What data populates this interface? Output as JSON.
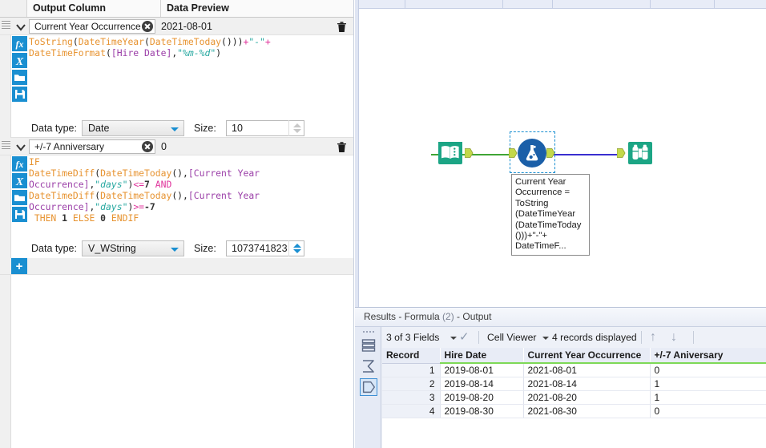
{
  "config_panel": {
    "columns": [
      "Output Column",
      "Data Preview"
    ],
    "formulas": [
      {
        "output_column": "Current Year Occurrence",
        "data_preview": "2021-08-01",
        "expression_plain": "ToString(DateTimeYear(DateTimeToday()))+\"-\"+DateTimeFormat([Hire Date],\"%m-%d\")",
        "data_type_label": "Data type:",
        "data_type": "Date",
        "size_label": "Size:",
        "size": "10",
        "spinner_enabled": false
      },
      {
        "output_column": "+/-7 Anniversary",
        "data_preview": "0",
        "expression_plain": "IF DateTimeDiff(DateTimeToday(),[Current Year Occurrence],\"days\")<=7 AND DateTimeDiff(DateTimeToday(),[Current Year Occurrence],\"days\")>=-7 THEN 1 ELSE 0 ENDIF",
        "data_type_label": "Data type:",
        "data_type": "V_WString",
        "size_label": "Size:",
        "size": "1073741823",
        "spinner_enabled": true
      }
    ],
    "tool_icons": [
      "fx-icon",
      "x-variable-icon",
      "open-folder-icon",
      "save-disk-icon"
    ],
    "add_button_label": "+"
  },
  "canvas": {
    "nodes": [
      {
        "id": "input-data-tool",
        "icon": "open-book-icon",
        "label": ""
      },
      {
        "id": "formula-tool",
        "icon": "flask-icon",
        "label": "Current Year Occurrence = ToString (DateTimeYear (DateTimeToday ()))+\"-\"+ DateTimeF..."
      },
      {
        "id": "browse-tool",
        "icon": "binoculars-icon",
        "label": ""
      }
    ],
    "node_label_lines": [
      "Current Year",
      "Occurrence =",
      "ToString",
      "(DateTimeYear",
      "(DateTimeToday",
      "()))+\"-\"+",
      "DateTimeF..."
    ],
    "colors": {
      "tool_green": "#1CA585",
      "formula_blue": "#1B5FA8",
      "wire_green": "#3FA535",
      "wire_blue": "#3A2FD0",
      "anchor_green": "#C3D84A",
      "selection": "#1a8fd1"
    }
  },
  "results": {
    "title_prefix": "Results - Formula",
    "title_count": "(2)",
    "title_suffix": "- Output",
    "toolbar": {
      "fields": "3 of 3 Fields",
      "viewer": "Cell Viewer",
      "records": "4 records displayed",
      "up_arrow": "↑",
      "down_arrow": "↓",
      "check": "✓"
    },
    "table": {
      "headers": [
        "Record",
        "Hire Date",
        "Current Year Occurrence",
        "+/-7 Aniversary"
      ],
      "rows": [
        [
          "1",
          "2019-08-01",
          "2021-08-01",
          "0"
        ],
        [
          "2",
          "2019-08-14",
          "2021-08-14",
          "1"
        ],
        [
          "3",
          "2019-08-20",
          "2021-08-20",
          "1"
        ],
        [
          "4",
          "2019-08-30",
          "2021-08-30",
          "0"
        ]
      ]
    },
    "sidebar_icons": [
      "data-grid-icon",
      "sigma-profile-icon",
      "metadata-icon"
    ]
  }
}
